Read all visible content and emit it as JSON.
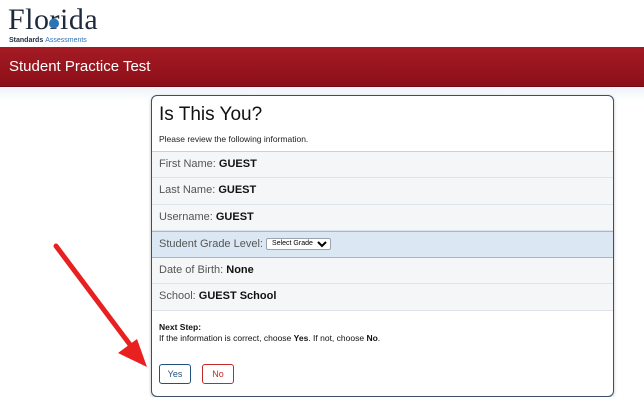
{
  "brand": {
    "logo_word": "Florida",
    "logo_sub_strong": "Standards",
    "logo_sub_light": "Assessments",
    "accent_color": "#2a74b8"
  },
  "header": {
    "title": "Student Practice Test",
    "bar_color": "#9a1620"
  },
  "dialog": {
    "title": "Is This You?",
    "instructions": "Please review the following information.",
    "fields": {
      "first_name": {
        "label": "First Name:",
        "value": "GUEST"
      },
      "last_name": {
        "label": "Last Name:",
        "value": "GUEST"
      },
      "username": {
        "label": "Username:",
        "value": "GUEST"
      },
      "grade": {
        "label": "Student Grade Level:",
        "selected": "Select Grade"
      },
      "dob": {
        "label": "Date of Birth:",
        "value": "None"
      },
      "school": {
        "label": "School:",
        "value": "GUEST School"
      }
    },
    "next_step": {
      "heading": "Next Step:",
      "text_before_yes": "If the information is correct, choose ",
      "yes_word": "Yes",
      "text_middle": ". If not, choose ",
      "no_word": "No",
      "text_end": "."
    },
    "buttons": {
      "yes_label": "Yes",
      "no_label": "No"
    },
    "colors": {
      "yes": "#23527c",
      "no": "#c62828",
      "highlight_row": "#dbe8f3"
    }
  },
  "annotation": {
    "arrow_color": "#e8201f",
    "arrow_icon": "red-arrow-icon"
  }
}
